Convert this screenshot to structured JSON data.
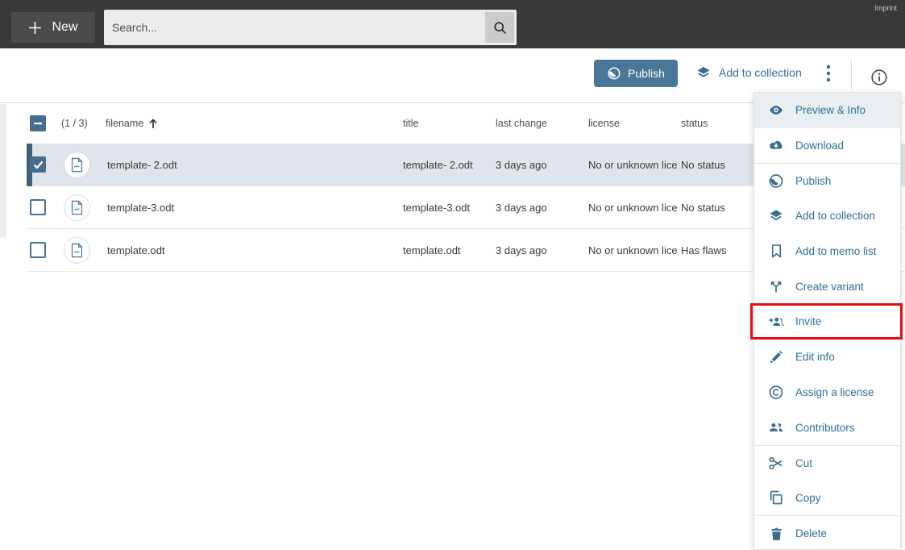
{
  "topbar": {
    "new_label": "New",
    "search_placeholder": "Search...",
    "imprint": "Imprint"
  },
  "toolbar": {
    "publish_label": "Publish",
    "add_to_collection_label": "Add to collection"
  },
  "table": {
    "count": "(1 / 3)",
    "columns": {
      "filename": "filename",
      "title": "title",
      "last_change": "last change",
      "license": "license",
      "status": "status"
    },
    "rows": [
      {
        "selected": true,
        "filename": "template- 2.odt",
        "title": "template- 2.odt",
        "last_change": "3 days ago",
        "license": "No or unknown lice",
        "status": "No status"
      },
      {
        "selected": false,
        "filename": "template-3.odt",
        "title": "template-3.odt",
        "last_change": "3 days ago",
        "license": "No or unknown lice",
        "status": "No status"
      },
      {
        "selected": false,
        "filename": "template.odt",
        "title": "template.odt",
        "last_change": "3 days ago",
        "license": "No or unknown lice",
        "status": "Has flaws"
      }
    ]
  },
  "menu": {
    "items": [
      {
        "label": "Preview & Info",
        "icon": "eye-icon"
      },
      {
        "label": "Download",
        "icon": "cloud-download-icon"
      },
      {
        "label": "Publish",
        "icon": "globe-icon"
      },
      {
        "label": "Add to collection",
        "icon": "layers-icon"
      },
      {
        "label": "Add to memo list",
        "icon": "bookmark-icon"
      },
      {
        "label": "Create variant",
        "icon": "variant-icon"
      },
      {
        "label": "Invite",
        "icon": "invite-icon"
      },
      {
        "label": "Edit info",
        "icon": "pencil-icon"
      },
      {
        "label": "Assign a license",
        "icon": "copyright-icon"
      },
      {
        "label": "Contributors",
        "icon": "people-icon"
      },
      {
        "label": "Cut",
        "icon": "scissors-icon"
      },
      {
        "label": "Copy",
        "icon": "copy-icon"
      },
      {
        "label": "Delete",
        "icon": "trash-icon"
      }
    ],
    "annotated_item": "Invite"
  },
  "colors": {
    "topbar_bg": "#393939",
    "accent_steel_blue": "#4a7698",
    "link_blue": "#2e7195",
    "icon_blue": "#3a6d92",
    "selected_row_bg": "#dfe5ea",
    "selected_stripe": "#3e6175",
    "annotation_red": "#e70b10"
  }
}
